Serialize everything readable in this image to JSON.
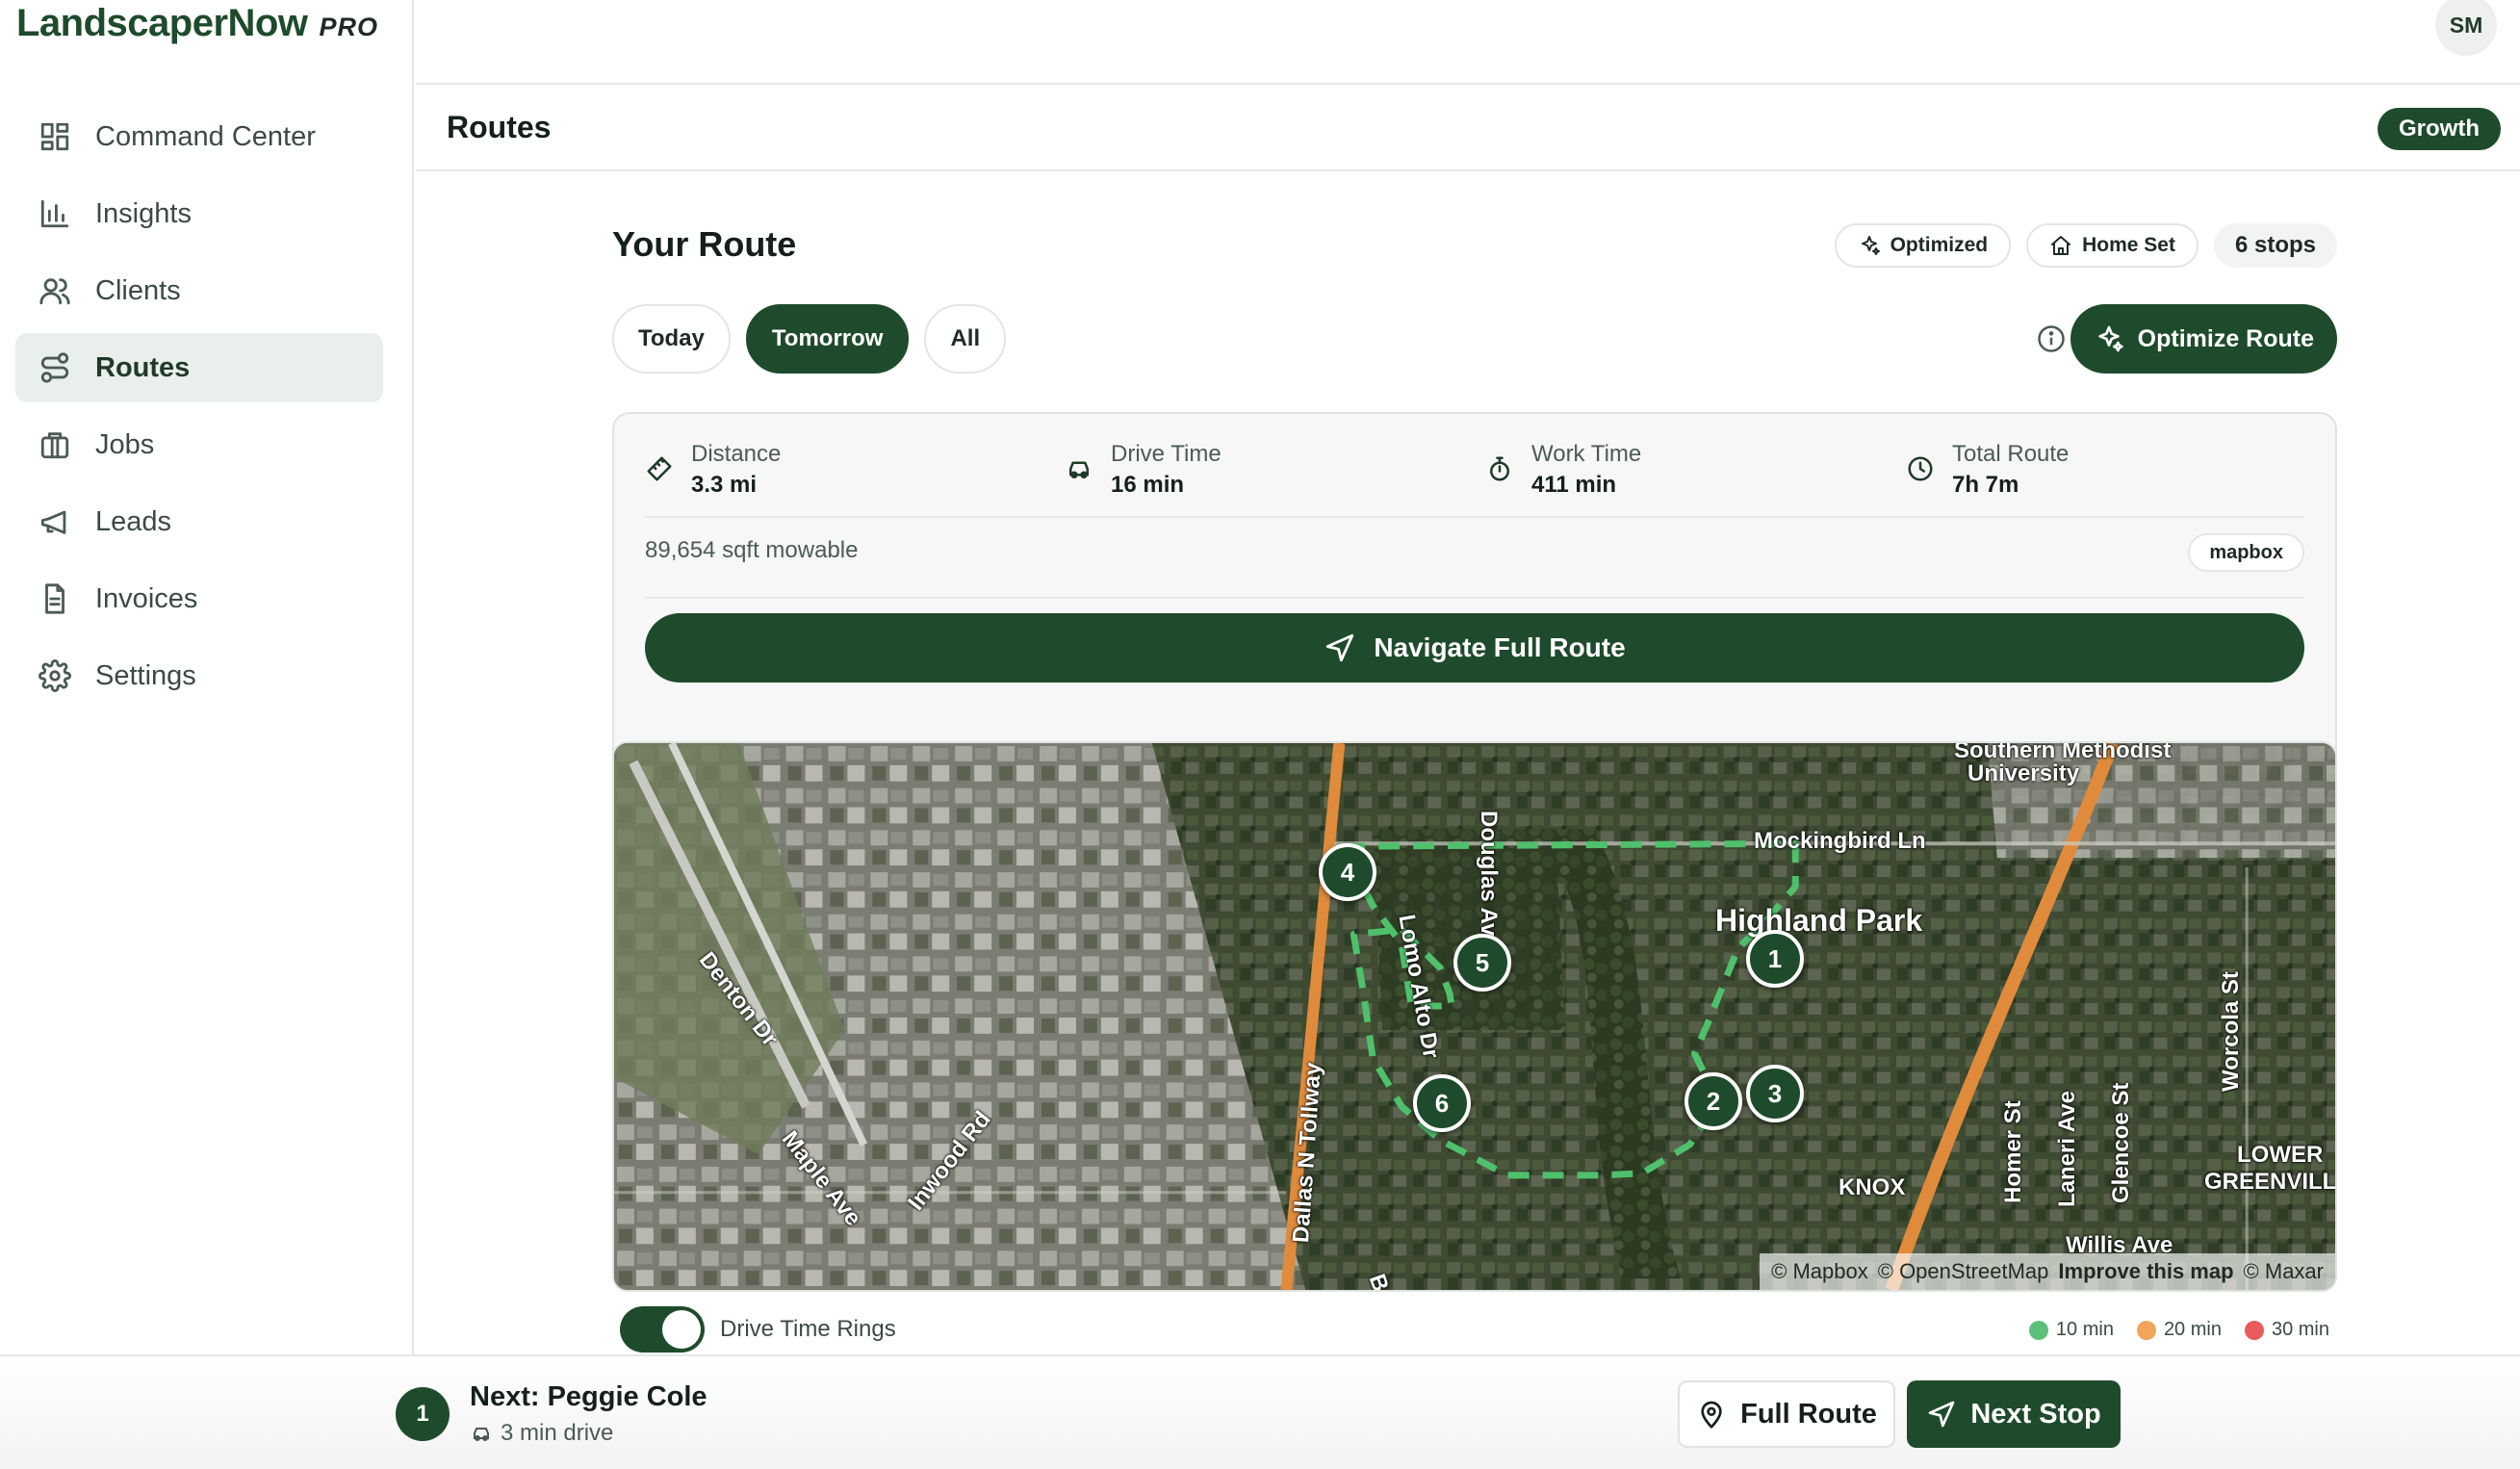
{
  "app": {
    "name": "LandscaperNow",
    "tier": "PRO",
    "user_initials": "SM"
  },
  "sidebar": {
    "items": [
      {
        "label": "Command Center",
        "icon": "grid-icon"
      },
      {
        "label": "Insights",
        "icon": "bar-chart-icon"
      },
      {
        "label": "Clients",
        "icon": "users-icon"
      },
      {
        "label": "Routes",
        "icon": "route-icon",
        "active": true
      },
      {
        "label": "Jobs",
        "icon": "briefcase-icon"
      },
      {
        "label": "Leads",
        "icon": "megaphone-icon"
      },
      {
        "label": "Invoices",
        "icon": "document-icon"
      },
      {
        "label": "Settings",
        "icon": "gear-icon"
      }
    ]
  },
  "header": {
    "page_title": "Routes",
    "plan_badge": "Growth"
  },
  "route": {
    "title": "Your Route",
    "chips": {
      "optimized": "Optimized",
      "home_set": "Home Set",
      "stops": "6 stops"
    },
    "tabs": [
      "Today",
      "Tomorrow",
      "All"
    ],
    "active_tab": "Tomorrow",
    "optimize_label": "Optimize Route",
    "stats": {
      "distance": {
        "label": "Distance",
        "value": "3.3 mi"
      },
      "drive_time": {
        "label": "Drive Time",
        "value": "16 min"
      },
      "work_time": {
        "label": "Work Time",
        "value": "411 min"
      },
      "total_route": {
        "label": "Total Route",
        "value": "7h 7m"
      }
    },
    "sqft": "89,654 sqft mowable",
    "map_provider": "mapbox",
    "navigate_label": "Navigate Full Route"
  },
  "map": {
    "labels": {
      "smu": "Southern Methodist",
      "smu2": "University",
      "mockingbird": "Mockingbird Ln",
      "highland_park": "Highland Park",
      "douglas": "Douglas Av",
      "lomo_alto": "Lomo Alto Dr",
      "denton": "Denton Dr",
      "maple": "Maple Ave",
      "inwood": "Inwood Rd",
      "tollway": "Dallas N Tollway",
      "knox": "KNOX",
      "homer": "Homer St",
      "laneri": "Laneri Ave",
      "glencoe": "Glencoe St",
      "worcola": "Worcola St",
      "lower": "LOWER",
      "greenville": "GREENVILL",
      "willis": "Willis Ave",
      "bo": "Bo"
    },
    "markers": [
      "1",
      "2",
      "3",
      "4",
      "5",
      "6"
    ],
    "attribution": {
      "mapbox": "© Mapbox",
      "osm": "© OpenStreetMap",
      "improve": "Improve this map",
      "maxar": "© Maxar"
    }
  },
  "drive_rings": {
    "label": "Drive Time Rings",
    "enabled": true,
    "legend": [
      {
        "label": "10 min",
        "color": "#5cc07a"
      },
      {
        "label": "20 min",
        "color": "#f2a45a"
      },
      {
        "label": "30 min",
        "color": "#e95a5a"
      }
    ]
  },
  "next": {
    "number": "1",
    "title": "Next: Peggie Cole",
    "drive": "3 min drive",
    "full_route_label": "Full Route",
    "next_stop_label": "Next Stop"
  },
  "colors": {
    "brand": "#1e4b2b",
    "route_line": "#3fae5f",
    "highway": "#e08a3c"
  }
}
